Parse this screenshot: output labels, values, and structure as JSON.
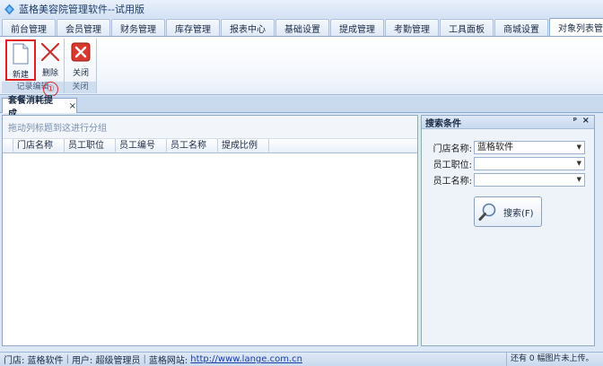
{
  "window": {
    "title": "蓝格美容院管理软件--试用版"
  },
  "ribbon_tabs": [
    "前台管理",
    "会员管理",
    "财务管理",
    "库存管理",
    "报表中心",
    "基础设置",
    "提成管理",
    "考勤管理",
    "工具面板",
    "商城设置",
    "对象列表管理"
  ],
  "ribbon": {
    "groups": [
      {
        "label": "记录编辑",
        "buttons": [
          "新建",
          "删除"
        ]
      },
      {
        "label": "关闭",
        "buttons": [
          "关闭"
        ]
      }
    ],
    "annotation": "①"
  },
  "document_tab": {
    "label": "套餐消耗提成",
    "close": "×"
  },
  "grid": {
    "group_hint": "拖动列标题到这进行分组",
    "columns": [
      "门店名称",
      "员工职位",
      "员工编号",
      "员工名称",
      "提成比例"
    ]
  },
  "search_panel": {
    "title": "搜索条件",
    "pin": "ᵖ",
    "close": "×",
    "fields": [
      {
        "label": "门店名称:",
        "value": "蓝格软件"
      },
      {
        "label": "员工职位:",
        "value": ""
      },
      {
        "label": "员工名称:",
        "value": ""
      }
    ],
    "search_button": "搜索(F)"
  },
  "status": {
    "store": "门店: 蓝格软件",
    "user": "用户: 超级管理员",
    "site_label": "蓝格网站:",
    "site_url": "http://www.lange.com.cn",
    "right_text": "还有 0 幅图片未上传。"
  },
  "colors": {
    "highlight": "#e02020",
    "accent": "#1d3b66"
  }
}
